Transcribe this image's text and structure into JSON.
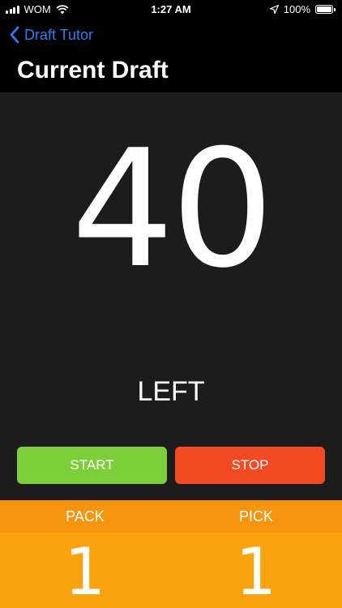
{
  "status_bar": {
    "carrier": "WOM",
    "time": "1:27 AM",
    "battery": "100%"
  },
  "nav": {
    "back_label": "Draft Tutor",
    "title": "Current Draft"
  },
  "counter": {
    "value": "40",
    "label": "LEFT"
  },
  "buttons": {
    "start": "START",
    "stop": "STOP"
  },
  "draft": {
    "pack_label": "PACK",
    "pack_value": "1",
    "pick_label": "PICK",
    "pick_value": "1"
  },
  "colors": {
    "back_link": "#2f7cf6",
    "start": "#7dcf3a",
    "stop": "#f44a24",
    "header_orange": "#f5950f",
    "value_orange": "#fba30e",
    "panel": "#1c1c1c"
  },
  "icons": [
    "signal-bars-icon",
    "wifi-icon",
    "location-arrow-icon",
    "battery-icon",
    "chevron-left-icon"
  ]
}
